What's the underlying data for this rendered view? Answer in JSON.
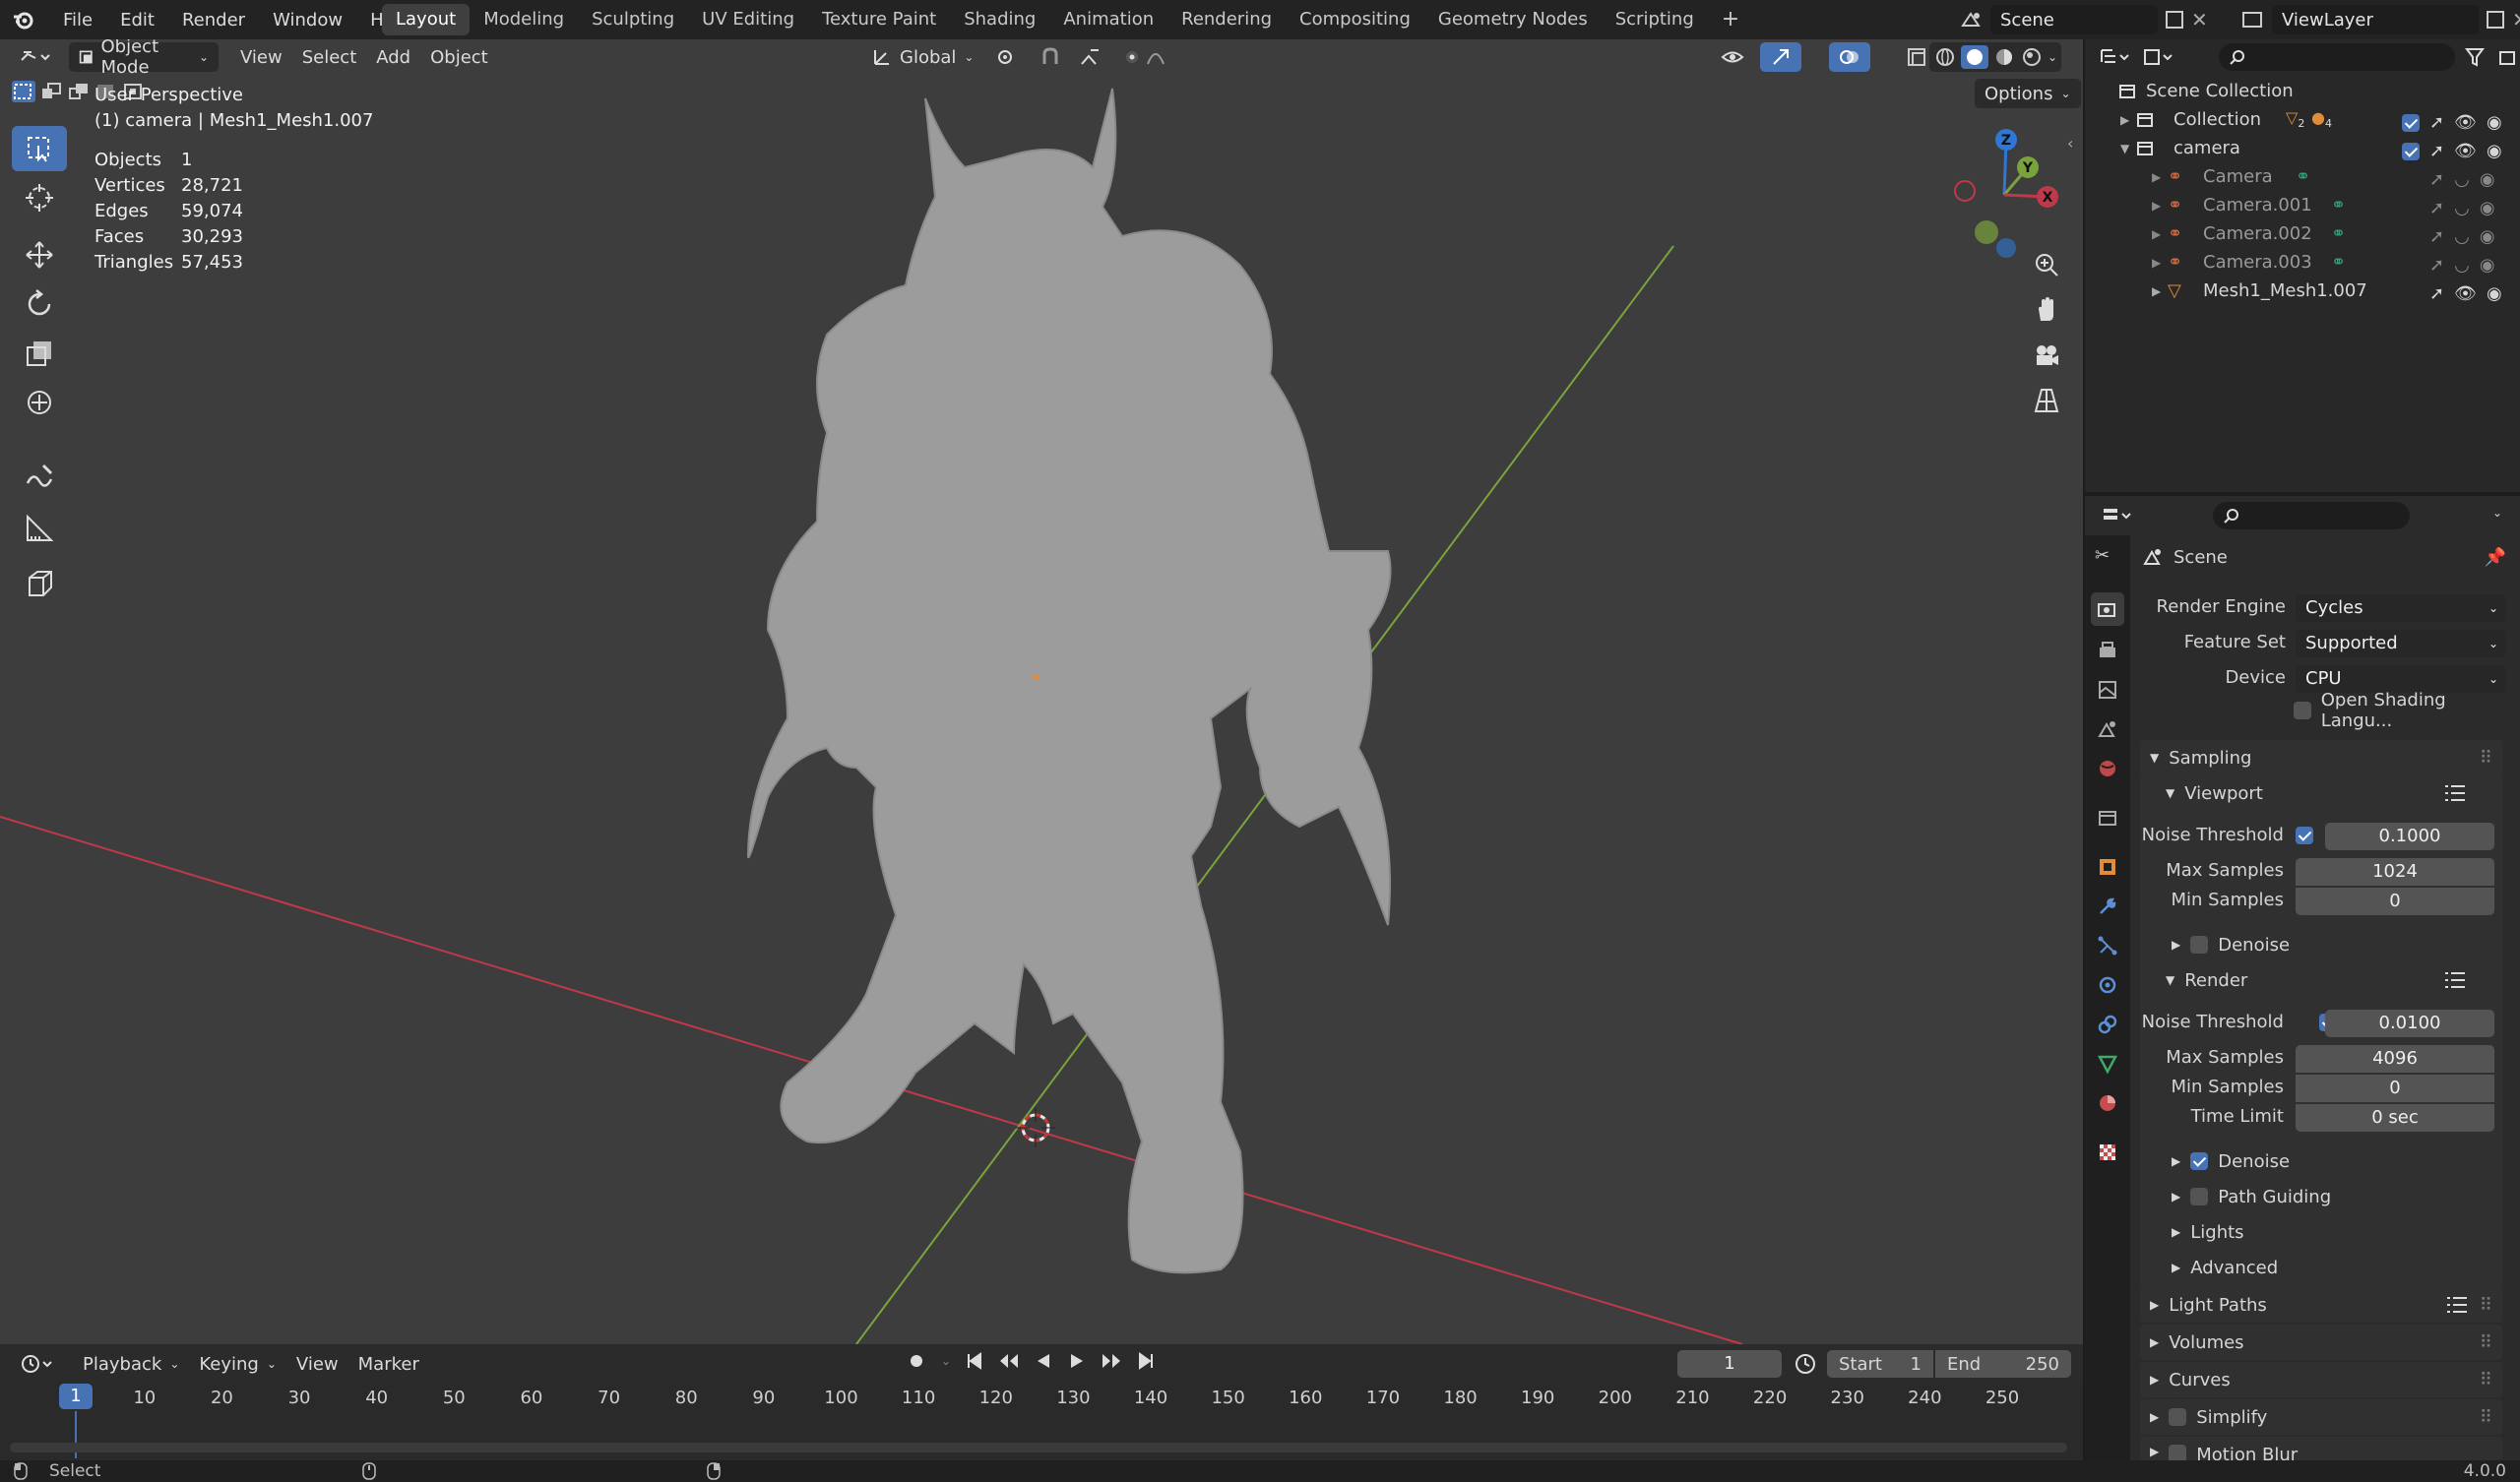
{
  "topbar": {
    "menu": [
      "File",
      "Edit",
      "Render",
      "Window",
      "Help"
    ],
    "workspaces": [
      "Layout",
      "Modeling",
      "Sculpting",
      "UV Editing",
      "Texture Paint",
      "Shading",
      "Animation",
      "Rendering",
      "Compositing",
      "Geometry Nodes",
      "Scripting"
    ],
    "active_workspace": "Layout",
    "scene": "Scene",
    "view_layer": "ViewLayer"
  },
  "viewport": {
    "mode": "Object Mode",
    "menus": [
      "View",
      "Select",
      "Add",
      "Object"
    ],
    "orientation": "Global",
    "options": "Options",
    "view_name": "User Perspective",
    "active": "(1) camera | Mesh1_Mesh1.007",
    "stats": [
      {
        "label": "Objects",
        "value": "1"
      },
      {
        "label": "Vertices",
        "value": "28,721"
      },
      {
        "label": "Edges",
        "value": "59,074"
      },
      {
        "label": "Faces",
        "value": "30,293"
      },
      {
        "label": "Triangles",
        "value": "57,453"
      }
    ],
    "gizmo": {
      "x": "X",
      "y": "Y",
      "z": "Z"
    }
  },
  "outliner": {
    "root": "Scene Collection",
    "rows": [
      {
        "name": "Collection",
        "indent": 1
      },
      {
        "name": "camera",
        "indent": 1
      },
      {
        "name": "Camera",
        "indent": 2
      },
      {
        "name": "Camera.001",
        "indent": 2
      },
      {
        "name": "Camera.002",
        "indent": 2
      },
      {
        "name": "Camera.003",
        "indent": 2
      },
      {
        "name": "Mesh1_Mesh1.007",
        "indent": 2
      }
    ],
    "collection_counts": [
      "2",
      "4"
    ]
  },
  "properties": {
    "context": "Scene",
    "render_engine_label": "Render Engine",
    "render_engine": "Cycles",
    "feature_set_label": "Feature Set",
    "feature_set": "Supported",
    "device_label": "Device",
    "device": "CPU",
    "osl": "Open Shading Langu...",
    "sampling": "Sampling",
    "viewport": "Viewport",
    "vp_noise_label": "Noise Threshold",
    "vp_noise": "0.1000",
    "vp_max_label": "Max Samples",
    "vp_max": "1024",
    "vp_min_label": "Min Samples",
    "vp_min": "0",
    "vp_denoise": "Denoise",
    "render": "Render",
    "r_noise_label": "Noise Threshold",
    "r_noise": "0.0100",
    "r_max_label": "Max Samples",
    "r_max": "4096",
    "r_min_label": "Min Samples",
    "r_min": "0",
    "r_time_label": "Time Limit",
    "r_time": "0 sec",
    "r_denoise": "Denoise",
    "path_guiding": "Path Guiding",
    "lights": "Lights",
    "advanced": "Advanced",
    "light_paths": "Light Paths",
    "volumes": "Volumes",
    "curves": "Curves",
    "simplify": "Simplify",
    "motion_blur": "Motion Blur"
  },
  "timeline": {
    "menus": [
      "Playback",
      "Keying",
      "View",
      "Marker"
    ],
    "current_frame": "1",
    "start_label": "Start",
    "start": "1",
    "end_label": "End",
    "end": "250",
    "ticks": [
      "1",
      "10",
      "20",
      "30",
      "40",
      "50",
      "60",
      "70",
      "80",
      "90",
      "100",
      "110",
      "120",
      "130",
      "140",
      "150",
      "160",
      "170",
      "180",
      "190",
      "200",
      "210",
      "220",
      "230",
      "240",
      "250"
    ]
  },
  "status": {
    "select": "Select",
    "version": "4.0.0"
  },
  "colors": {
    "accent": "#4772b3",
    "x_axis": "#c0394a",
    "y_axis": "#7aa33c",
    "z_axis": "#2f77d4"
  }
}
